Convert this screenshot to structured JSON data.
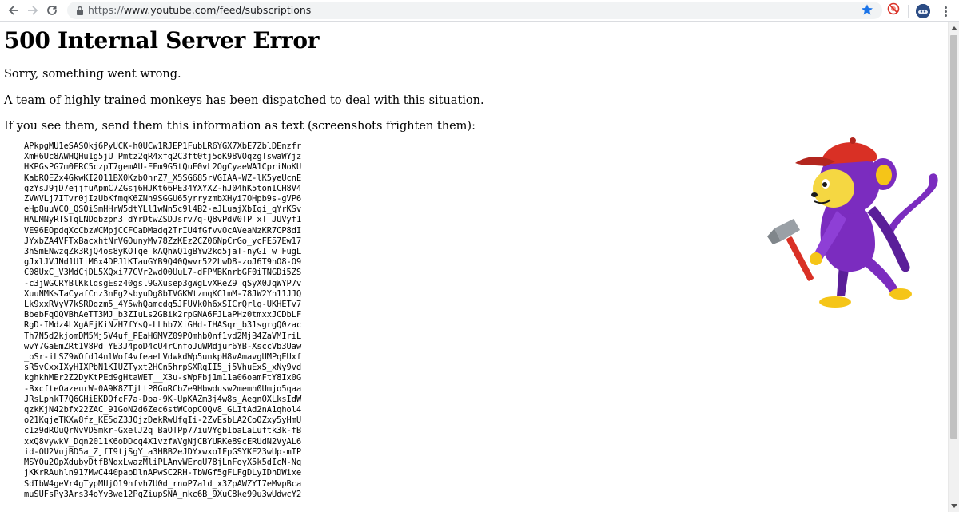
{
  "browser": {
    "url_scheme": "https://",
    "url_rest": "www.youtube.com/feed/subscriptions"
  },
  "page": {
    "title": "500 Internal Server Error",
    "line1": "Sorry, something went wrong.",
    "line2": "A team of highly trained monkeys has been dispatched to deal with this situation.",
    "line3": "If you see them, send them this information as text (screenshots frighten them):",
    "error_blob": "APkpgMU1eSAS0kj6PyUCK-h0UCw1RJEP1FubLR6YGX7XbE7ZblDEnzfr\nXmH6Uc8AWHQHu1g5jU_Pmtz2qR4xfq2C3ft0tj5oK98VOqzgTswaWYjz\nHKPGsPG7m0FRC5czpT7gemAU-EFm9G5tQuF0vL2OgCyaeWA1CpriNoKU\nKabRQEZx4GkwKI2011BX0Kzb0hrZ7_X5SG685rVGIAA-WZ-lK5yeUcnE\ngzYsJ9jD7ejjfuApmC7ZGsj6HJKt66PE34YXYXZ-hJ04hK5tonICH8V4\nZVWVLj7ITvr0jIzUbKfmqK6ZNh9SGGU65yrryzmbXHyi7OHpb9s-gVP6\neHp8uuVCO_QSOiSmHHrW5dtYLl1wNn5c9l4B2-eJLuajXbIqi_qYrKSv\nHALMNyRTSTqLNDqbzpn3_dYrDtwZSDJsrv7q-Q8vPdV0TP_xT_JUVyf1\nVE96EOpdqXcCbzWCMpjCCFCaDMadq2TrIU4fGfvvOcAVeaNzKR7CP8dI\nJYxbZA4VFTxBacxhtNrVGOunyMv78ZzKEz2CZ06NpCrGo_ycFE57Ew17\n3hSmENwzqZk3RjQ4os8yKOTqe_kAQhWQ1gBYw2kq5jaT-nyGI_w_FugL\ngJxlJVJNd1UIiM6x4DPJlKTauGYB9Q40Qwvr522LwD8-zoJ6T9hO8-O9\nC08UxC_V3MdCjDL5XQxi77GVr2wd00UuL7-dFPMBKnrbGF0iTNGDi5ZS\n-c3jWGCRYBlKklqsgEsz40gsl9GXusep3gWgLvXReZ9_qSyX0JqWYP7v\nXuuNMKsTaCyafCnz3nFg2sbyuDg8bTVGKWtzmqKClmM-78JW2Yn11JJQ\nLk9xxRVyV7kSRDqzm5_4Y5whQamcdq5JFUVk0h6xSICrQrlq-UKHETv7\nBbebFqOQVBhAeTT3MJ_b3ZIuLs2GBik2rpGNA6FJLaPHz0tmxxJCDbLF\nRgD-IMdz4LXgAFjKiNzH7fYsQ-LLhb7XiGHd-IHASqr_b31sgrgQ0zac\nTh7N5d2kjomDM5Mj5V4uf_PEaH6MVZ09PQmhb0nf1vd2MjB4ZaVMIriL\nwvY7GaEmZRt1V8Pd_YE3J4poD4cU4rCnfoJuWMdjur6YB-XsccVb3Uaw\n_oSr-iLSZ9WOfdJ4nlWof4vfeaeLVdwkdWp5unkpH8vAmavgUMPqEUxf\nsR5vCxxIXyHIXPbN1KIUZTyxt2HCn5hrpSXRqII5_j5VhuExS_xNy9vd\nkghkhMEr2Z2DyKtPEd9gHtaWET__X3u-sWpFbj1m11a06oamFtY8Ix0G\n-BxcfteOazeurW-0A9K8ZTjLtP8GoRCbZe9Hbwdusw2memh0Umjo5qaa\nJRsLphkT7Q6GHiEKDOfcF7a-Dpa-9K-UpKAZm3j4w8s_AegnOXLksIdW\nqzkKjN42bfx22ZAC_91GoN2d6Zec6stWCopCOQv8_GLItAd2nA1qhol4\no21KqjeTKXw8fz_KE5dZ3JOjzDekRwUfqIi-2ZvEsbLA2CoOZxy5yHmU\nc1z9dROuQrNvVDSmkr-GxelJ2q_BaOTPp77iuVYgbIbaLaLuftk3k-fB\nxxQ8vywkV_Dqn2011K6oDDcq4X1vzfWVgNjCBYURKe89cERUdN2VyAL6\nid-OU2VujBD5a_ZjfT9tjSgY_a3HBB2eJDYxwxoIFpGSYKE23wUp-mTP\nMSYOu2OpXdubyDtfBNqxLwazMliPLAnvWErgU78jLnFoyX5k5dIcN-Nq\njKKrRAuhln917MwC440pabDlnAPwSC2RH-TbWGf5gFLFgDLyIDhDWixe\nSdIbW4geVr4gTypMUjO19hfvh7U0d_rnoP7ald_x3ZpAWZYI7eMvpBca\nmuSUFsPy3Ars34oYv3we12PqZiupSNA_mkc6B_9XuC8ke99u3wUdwcY2"
  },
  "icons": {
    "back": "back-arrow-icon",
    "forward": "forward-arrow-icon",
    "reload": "reload-icon",
    "lock": "lock-icon",
    "bookmark": "star-icon",
    "extension": "blocked-extension-icon",
    "profile": "profile-avatar",
    "menu": "more-vert-icon"
  },
  "colors": {
    "star": "#1a73e8",
    "extension": "#d93025",
    "monkey_fur": "#7b2cbf",
    "monkey_face": "#f5d742",
    "monkey_cap": "#d93025"
  }
}
